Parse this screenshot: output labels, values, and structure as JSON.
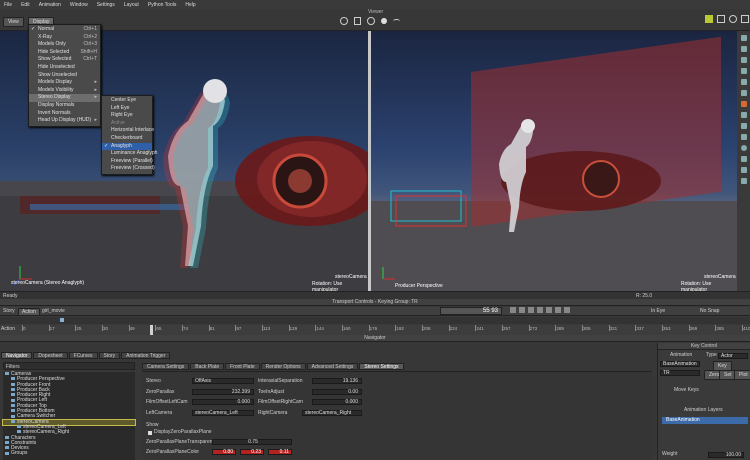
{
  "menubar": [
    "File",
    "Edit",
    "Animation",
    "Window",
    "Settings",
    "Layout",
    "Python Tools",
    "Help"
  ],
  "toolbar": {
    "title": "Viewer",
    "btn_left": "View",
    "btn_display": "Display"
  },
  "display_menu": [
    {
      "label": "Normal",
      "shortcut": "Ctrl+1",
      "check": true
    },
    {
      "label": "X-Ray",
      "shortcut": "Ctrl+2"
    },
    {
      "label": "Models Only",
      "shortcut": "Ctrl+3"
    },
    {
      "label": "Hide Selected",
      "shortcut": "Shift+H"
    },
    {
      "label": "Show Selected",
      "shortcut": "Ctrl+T"
    },
    {
      "label": "Hide Unselected",
      "shortcut": ""
    },
    {
      "label": "Show Unselected",
      "shortcut": ""
    },
    {
      "label": "Models Display",
      "shortcut": "▸"
    },
    {
      "label": "Models Visibility",
      "shortcut": "▸"
    },
    {
      "label": "Stereo Display",
      "shortcut": "▸",
      "hl": true
    },
    {
      "label": "Display Normals",
      "shortcut": ""
    },
    {
      "label": "Invert Normals",
      "shortcut": ""
    },
    {
      "label": "Head Up Display (HUD)",
      "shortcut": "▸"
    }
  ],
  "stereo_submenu": [
    {
      "label": "Center Eye"
    },
    {
      "label": "Left Eye"
    },
    {
      "label": "Right Eye"
    },
    {
      "label": "Active",
      "dim": true
    },
    {
      "label": "Horizontal Interlace"
    },
    {
      "label": "Checkerboard"
    },
    {
      "label": "Anaglyph",
      "check": true,
      "hl": true
    },
    {
      "label": "Luminance Anaglyph"
    },
    {
      "label": "Freeview (Parallel)"
    },
    {
      "label": "Freeview (Crossed)"
    }
  ],
  "viewport_left": {
    "cam_name": "stereoCamera",
    "cam_info": "stereoCamera (Stereo Anaglyph)",
    "manip": "Rotation: Use manipulator"
  },
  "viewport_right": {
    "cam_name": "stereoCamera",
    "cam_info": "Producer Perspective",
    "manip": "Rotation: Use manipulator"
  },
  "status": {
    "left": "Ready",
    "right": "R: 25.0"
  },
  "transport": {
    "title": "Transport Controls - Keying Group: TR",
    "story": "Story",
    "action": "Action",
    "take": "girl_movie",
    "frame_a": "55",
    "frame_b": "93",
    "mode": "In Eye",
    "no_snap": "No Snap",
    "action_label": "Action",
    "ticks": [
      "0",
      "17",
      "25",
      "30",
      "49",
      "65",
      "74",
      "81",
      "97",
      "113",
      "129",
      "144",
      "160",
      "176",
      "192",
      "208",
      "224",
      "241",
      "257",
      "273",
      "289",
      "305",
      "321",
      "337",
      "353",
      "369",
      "385",
      "410"
    ]
  },
  "bottom": {
    "title": "Navigator",
    "tabs": [
      "Navigator",
      "Dopesheet",
      "FCurves",
      "Story",
      "Animation Trigger"
    ],
    "filter_label": "Filters",
    "tree": [
      {
        "label": "Cameras",
        "indent": 0
      },
      {
        "label": "Producer Perspective",
        "indent": 1
      },
      {
        "label": "Producer Front",
        "indent": 1
      },
      {
        "label": "Producer Back",
        "indent": 1
      },
      {
        "label": "Producer Right",
        "indent": 1
      },
      {
        "label": "Producer Left",
        "indent": 1
      },
      {
        "label": "Producer Top",
        "indent": 1
      },
      {
        "label": "Producer Bottom",
        "indent": 1
      },
      {
        "label": "Camera Switcher",
        "indent": 1
      },
      {
        "label": "stereoCamera",
        "indent": 1,
        "sel": true
      },
      {
        "label": "stereoCamera_Left",
        "indent": 2
      },
      {
        "label": "stereoCamera_Right",
        "indent": 2
      },
      {
        "label": "Characters",
        "indent": 0
      },
      {
        "label": "Constraints",
        "indent": 0
      },
      {
        "label": "Devices",
        "indent": 0
      },
      {
        "label": "Groups",
        "indent": 0
      }
    ],
    "settings_tabs": [
      "Camera Settings",
      "Back Plate",
      "Front Plate",
      "Render Options",
      "Advanced Settings",
      "Stereo Settings"
    ],
    "props": {
      "stereo_label": "Stereo",
      "stereo_val": "OffAxis",
      "interaxial_label": "InteraxialSeparation",
      "interaxial_val": "19.136",
      "zero_label": "ZeroParallax",
      "zero_val": "232.399",
      "toein_label": "ToeInAdjust",
      "toein_val": "0.00",
      "filmleft_label": "FilmOffsetRightCam",
      "filmleft_val": "0.000",
      "filmright_label": "FilmOffsetLeftCam",
      "filmright_val": "0.000",
      "leftcam_label": "LeftCamera",
      "leftcam_val": "stereoCamera_Left",
      "rightcam_label": "RightCamera",
      "rightcam_val": "stereoCamera_Right",
      "show_label": "Show",
      "display_plane": "DisplayZeroParallaxPlane",
      "transparency_label": "ZeroParallaxPlaneTransparency",
      "transparency_val": "0.75",
      "color_label": "ZeroParallaxPlaneColor",
      "color_r": "0.80",
      "color_g": "0.23",
      "color_b": "0.11"
    },
    "keycontrol": {
      "title": "Key Control",
      "animation": "Animation",
      "type": "Type",
      "type_val": "Actor",
      "base_anim": "BaseAnimation",
      "key": "Key",
      "zero": "Zero",
      "tr": "TR",
      "set": "Set",
      "plot": "Plot",
      "move_keys": "Move Keys",
      "layer_title": "Animation Layers",
      "base_layer": "BaseAnimation",
      "weight": "Weight",
      "weight_val": "100.00"
    }
  }
}
